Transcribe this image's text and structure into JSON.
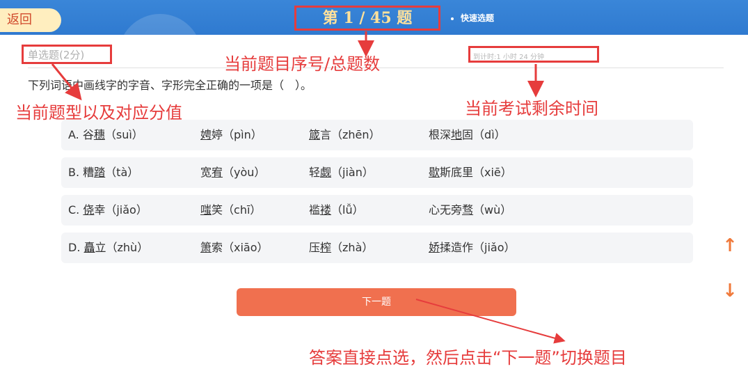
{
  "header": {
    "back_label": "返回",
    "counter": "第 1 / 45 题",
    "quick_select": "快速选题"
  },
  "question": {
    "type_label": "单选题(2分)",
    "timer": "到计时:1 小时 24 分钟",
    "text": "下列词语中画线字的字音、字形完全正确的一项是（　）。"
  },
  "options": [
    [
      {
        "pre": "A. 谷",
        "u": "穗",
        "post": "（suì）"
      },
      {
        "pre": "",
        "u": "娉",
        "post": "婷（pìn）"
      },
      {
        "pre": "",
        "u": "箴",
        "post": "言（zhēn）"
      },
      {
        "pre": "根深",
        "u": "地",
        "post": "固（dì）"
      }
    ],
    [
      {
        "pre": "B. 糟",
        "u": "踏",
        "post": "（tà）"
      },
      {
        "pre": "宽",
        "u": "宥",
        "post": "（yòu）"
      },
      {
        "pre": "轻",
        "u": "觑",
        "post": "（jiàn）"
      },
      {
        "pre": "",
        "u": "歇",
        "post": "斯底里（xiē）"
      }
    ],
    [
      {
        "pre": "C. ",
        "u": "侥",
        "post": "幸（jiǎo）"
      },
      {
        "pre": "",
        "u": "嗤",
        "post": "笑（chī）"
      },
      {
        "pre": "褴",
        "u": "褛",
        "post": "（lǚ）"
      },
      {
        "pre": "心无旁",
        "u": "骛",
        "post": "（wù）"
      }
    ],
    [
      {
        "pre": "D. ",
        "u": "矗",
        "post": "立（zhù）"
      },
      {
        "pre": "",
        "u": "箫",
        "post": "索（xiāo）"
      },
      {
        "pre": "压",
        "u": "榨",
        "post": "（zhà）"
      },
      {
        "pre": "",
        "u": "娇",
        "post": "揉造作（jiǎo）"
      }
    ]
  ],
  "next_label": "下一题",
  "annotations": {
    "counter_note": "当前题目序号/总题数",
    "type_note": "当前题型以及对应分值",
    "timer_note": "当前考试剩余时间",
    "answer_note": "答案直接点选，然后点击“下一题”切换题目"
  },
  "icons": {
    "up": "arrow-up-icon",
    "down": "arrow-down-icon"
  },
  "colors": {
    "header_blue": "#2f7ad0",
    "annotation_red": "#e63c3c",
    "button_orange": "#f0704f"
  }
}
